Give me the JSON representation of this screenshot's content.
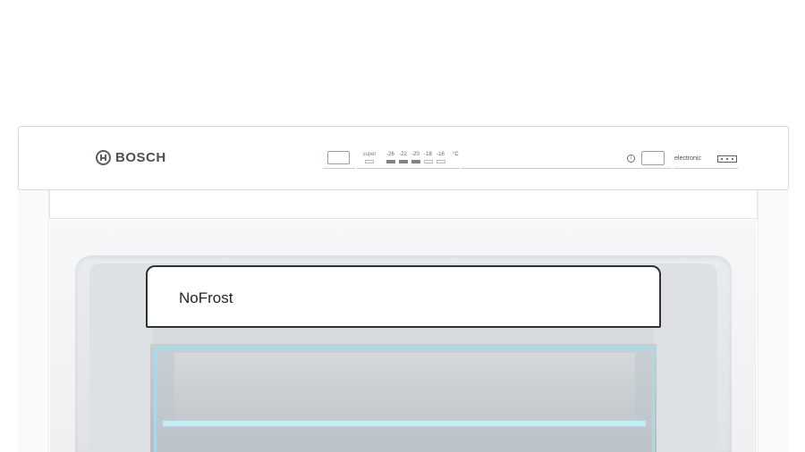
{
  "brand": {
    "name": "BOSCH"
  },
  "control_panel": {
    "super_label": "super",
    "temperatures": [
      "-26",
      "-22",
      "-20",
      "-18",
      "-16"
    ],
    "temperature_states": [
      "on",
      "on",
      "on",
      "off",
      "off"
    ],
    "unit": "°C",
    "info_symbol": "i",
    "electronic_label": "electronic",
    "alarm_icon": "alarm-off-icon"
  },
  "drawer": {
    "label": "NoFrost"
  },
  "colors": {
    "panel_text": "#4c5158",
    "glass_trim": "#a9d8e8",
    "led_on": "#808489"
  }
}
